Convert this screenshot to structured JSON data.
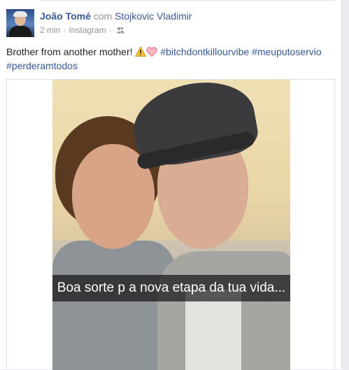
{
  "post": {
    "author": "João Tomé",
    "with_word": "com",
    "tagged_user": "Stojkovic Vladimir",
    "timestamp": "2 min",
    "separator": "·",
    "source": "Instagram",
    "privacy_icon": "friends-icon",
    "text_main": "Brother from another mother!",
    "emojis": [
      "warning-icon",
      "heart-icon"
    ],
    "hashtags": [
      "#bitchdontkillourvibe",
      "#meuputoservio",
      "#perderamtodos"
    ]
  },
  "photo": {
    "caption": "Boa sorte p a nova etapa da tua vida..."
  },
  "colors": {
    "link": "#3b5998",
    "hashtag": "#365899",
    "meta": "#90949c",
    "text": "#1d2129",
    "background": "#e9ebee"
  }
}
